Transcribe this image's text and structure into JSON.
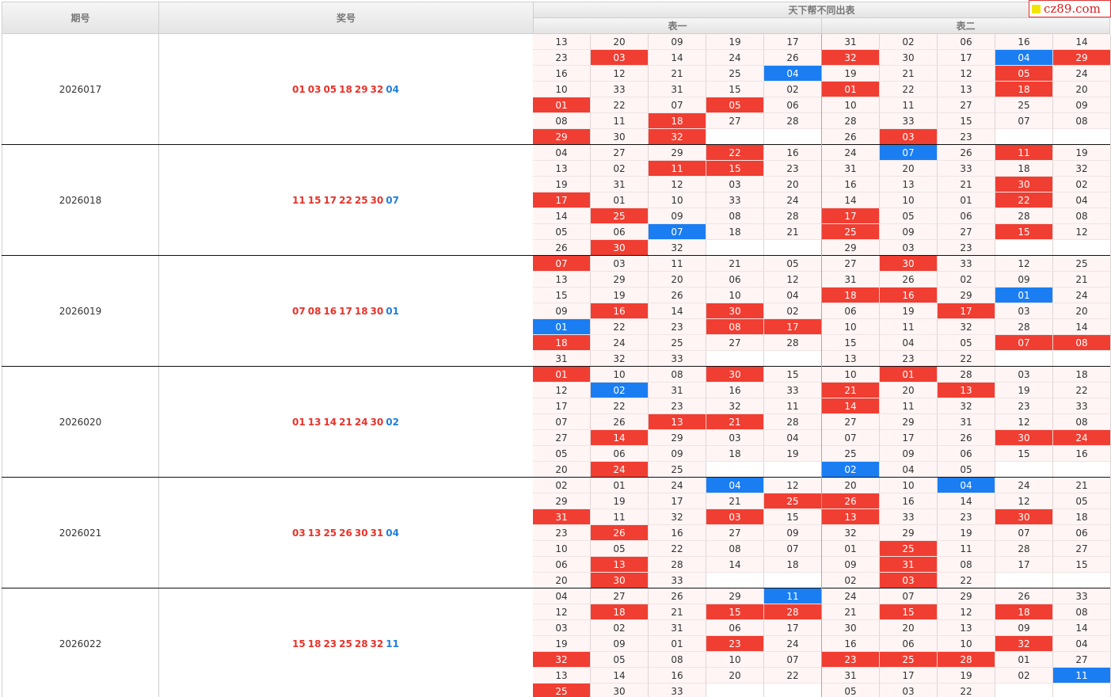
{
  "header": {
    "col_issue": "期号",
    "col_winning": "奖号",
    "group_title": "天下帮不同出表",
    "table1": "表一",
    "table2": "表二"
  },
  "logo_text": "cz89.com",
  "colors": {
    "red": "#f03e32",
    "blue": "#1a7ef2",
    "win_red": "#e8332a",
    "win_blue": "#1f7fde"
  },
  "rows": [
    {
      "issue": "2026017",
      "red_numbers": [
        "01",
        "03",
        "05",
        "18",
        "29",
        "32"
      ],
      "blue_number": "04",
      "table1": [
        [
          "13",
          "20",
          "09",
          "19",
          "17"
        ],
        [
          "23",
          "03",
          "14",
          "24",
          "26"
        ],
        [
          "16",
          "12",
          "21",
          "25",
          "04"
        ],
        [
          "10",
          "33",
          "31",
          "15",
          "02"
        ],
        [
          "01",
          "22",
          "07",
          "05",
          "06"
        ],
        [
          "08",
          "11",
          "18",
          "27",
          "28"
        ],
        [
          "29",
          "30",
          "32",
          "",
          ""
        ]
      ],
      "table2": [
        [
          "31",
          "02",
          "06",
          "16",
          "14"
        ],
        [
          "32",
          "30",
          "17",
          "04",
          "29"
        ],
        [
          "19",
          "21",
          "12",
          "05",
          "24"
        ],
        [
          "01",
          "22",
          "13",
          "18",
          "20"
        ],
        [
          "10",
          "11",
          "27",
          "25",
          "09"
        ],
        [
          "28",
          "33",
          "15",
          "07",
          "08"
        ],
        [
          "26",
          "03",
          "23",
          "",
          ""
        ]
      ]
    },
    {
      "issue": "2026018",
      "red_numbers": [
        "11",
        "15",
        "17",
        "22",
        "25",
        "30"
      ],
      "blue_number": "07",
      "table1": [
        [
          "04",
          "27",
          "29",
          "22",
          "16"
        ],
        [
          "13",
          "02",
          "11",
          "15",
          "23"
        ],
        [
          "19",
          "31",
          "12",
          "03",
          "20"
        ],
        [
          "17",
          "01",
          "10",
          "33",
          "24"
        ],
        [
          "14",
          "25",
          "09",
          "08",
          "28"
        ],
        [
          "05",
          "06",
          "07",
          "18",
          "21"
        ],
        [
          "26",
          "30",
          "32",
          "",
          ""
        ]
      ],
      "table2": [
        [
          "24",
          "07",
          "26",
          "11",
          "19"
        ],
        [
          "31",
          "20",
          "33",
          "18",
          "32"
        ],
        [
          "16",
          "13",
          "21",
          "30",
          "02"
        ],
        [
          "14",
          "10",
          "01",
          "22",
          "04"
        ],
        [
          "17",
          "05",
          "06",
          "28",
          "08"
        ],
        [
          "25",
          "09",
          "27",
          "15",
          "12"
        ],
        [
          "29",
          "03",
          "23",
          "",
          ""
        ]
      ]
    },
    {
      "issue": "2026019",
      "red_numbers": [
        "07",
        "08",
        "16",
        "17",
        "18",
        "30"
      ],
      "blue_number": "01",
      "table1": [
        [
          "07",
          "03",
          "11",
          "21",
          "05"
        ],
        [
          "13",
          "29",
          "20",
          "06",
          "12"
        ],
        [
          "15",
          "19",
          "26",
          "10",
          "04"
        ],
        [
          "09",
          "16",
          "14",
          "30",
          "02"
        ],
        [
          "01",
          "22",
          "23",
          "08",
          "17"
        ],
        [
          "18",
          "24",
          "25",
          "27",
          "28"
        ],
        [
          "31",
          "32",
          "33",
          "",
          ""
        ]
      ],
      "table2": [
        [
          "27",
          "30",
          "33",
          "12",
          "25"
        ],
        [
          "31",
          "26",
          "02",
          "09",
          "21"
        ],
        [
          "18",
          "16",
          "29",
          "01",
          "24"
        ],
        [
          "06",
          "19",
          "17",
          "03",
          "20"
        ],
        [
          "10",
          "11",
          "32",
          "28",
          "14"
        ],
        [
          "15",
          "04",
          "05",
          "07",
          "08"
        ],
        [
          "13",
          "23",
          "22",
          "",
          ""
        ]
      ]
    },
    {
      "issue": "2026020",
      "red_numbers": [
        "01",
        "13",
        "14",
        "21",
        "24",
        "30"
      ],
      "blue_number": "02",
      "table1": [
        [
          "01",
          "10",
          "08",
          "30",
          "15"
        ],
        [
          "12",
          "02",
          "31",
          "16",
          "33"
        ],
        [
          "17",
          "22",
          "23",
          "32",
          "11"
        ],
        [
          "07",
          "26",
          "13",
          "21",
          "28"
        ],
        [
          "27",
          "14",
          "29",
          "03",
          "04"
        ],
        [
          "05",
          "06",
          "09",
          "18",
          "19"
        ],
        [
          "20",
          "24",
          "25",
          "",
          ""
        ]
      ],
      "table2": [
        [
          "10",
          "01",
          "28",
          "03",
          "18"
        ],
        [
          "21",
          "20",
          "13",
          "19",
          "22"
        ],
        [
          "14",
          "11",
          "32",
          "23",
          "33"
        ],
        [
          "27",
          "29",
          "31",
          "12",
          "08"
        ],
        [
          "07",
          "17",
          "26",
          "30",
          "24"
        ],
        [
          "25",
          "09",
          "06",
          "15",
          "16"
        ],
        [
          "02",
          "04",
          "05",
          "",
          ""
        ]
      ]
    },
    {
      "issue": "2026021",
      "red_numbers": [
        "03",
        "13",
        "25",
        "26",
        "30",
        "31"
      ],
      "blue_number": "04",
      "table1": [
        [
          "02",
          "01",
          "24",
          "04",
          "12"
        ],
        [
          "29",
          "19",
          "17",
          "21",
          "25"
        ],
        [
          "31",
          "11",
          "32",
          "03",
          "15"
        ],
        [
          "23",
          "26",
          "16",
          "27",
          "09"
        ],
        [
          "10",
          "05",
          "22",
          "08",
          "07"
        ],
        [
          "06",
          "13",
          "28",
          "14",
          "18"
        ],
        [
          "20",
          "30",
          "33",
          "",
          ""
        ]
      ],
      "table2": [
        [
          "20",
          "10",
          "04",
          "24",
          "21"
        ],
        [
          "26",
          "16",
          "14",
          "12",
          "05"
        ],
        [
          "13",
          "33",
          "23",
          "30",
          "18"
        ],
        [
          "32",
          "29",
          "19",
          "07",
          "06"
        ],
        [
          "01",
          "25",
          "11",
          "28",
          "27"
        ],
        [
          "09",
          "31",
          "08",
          "17",
          "15"
        ],
        [
          "02",
          "03",
          "22",
          "",
          ""
        ]
      ]
    },
    {
      "issue": "2026022",
      "red_numbers": [
        "15",
        "18",
        "23",
        "25",
        "28",
        "32"
      ],
      "blue_number": "11",
      "table1": [
        [
          "04",
          "27",
          "26",
          "29",
          "11"
        ],
        [
          "12",
          "18",
          "21",
          "15",
          "28"
        ],
        [
          "03",
          "02",
          "31",
          "06",
          "17"
        ],
        [
          "19",
          "09",
          "01",
          "23",
          "24"
        ],
        [
          "32",
          "05",
          "08",
          "10",
          "07"
        ],
        [
          "13",
          "14",
          "16",
          "20",
          "22"
        ],
        [
          "25",
          "30",
          "33",
          "",
          ""
        ]
      ],
      "table2": [
        [
          "24",
          "07",
          "29",
          "26",
          "33"
        ],
        [
          "21",
          "15",
          "12",
          "18",
          "08"
        ],
        [
          "30",
          "20",
          "13",
          "09",
          "14"
        ],
        [
          "16",
          "06",
          "10",
          "32",
          "04"
        ],
        [
          "23",
          "25",
          "28",
          "01",
          "27"
        ],
        [
          "31",
          "17",
          "19",
          "02",
          "11"
        ],
        [
          "05",
          "03",
          "22",
          "",
          ""
        ]
      ]
    }
  ]
}
